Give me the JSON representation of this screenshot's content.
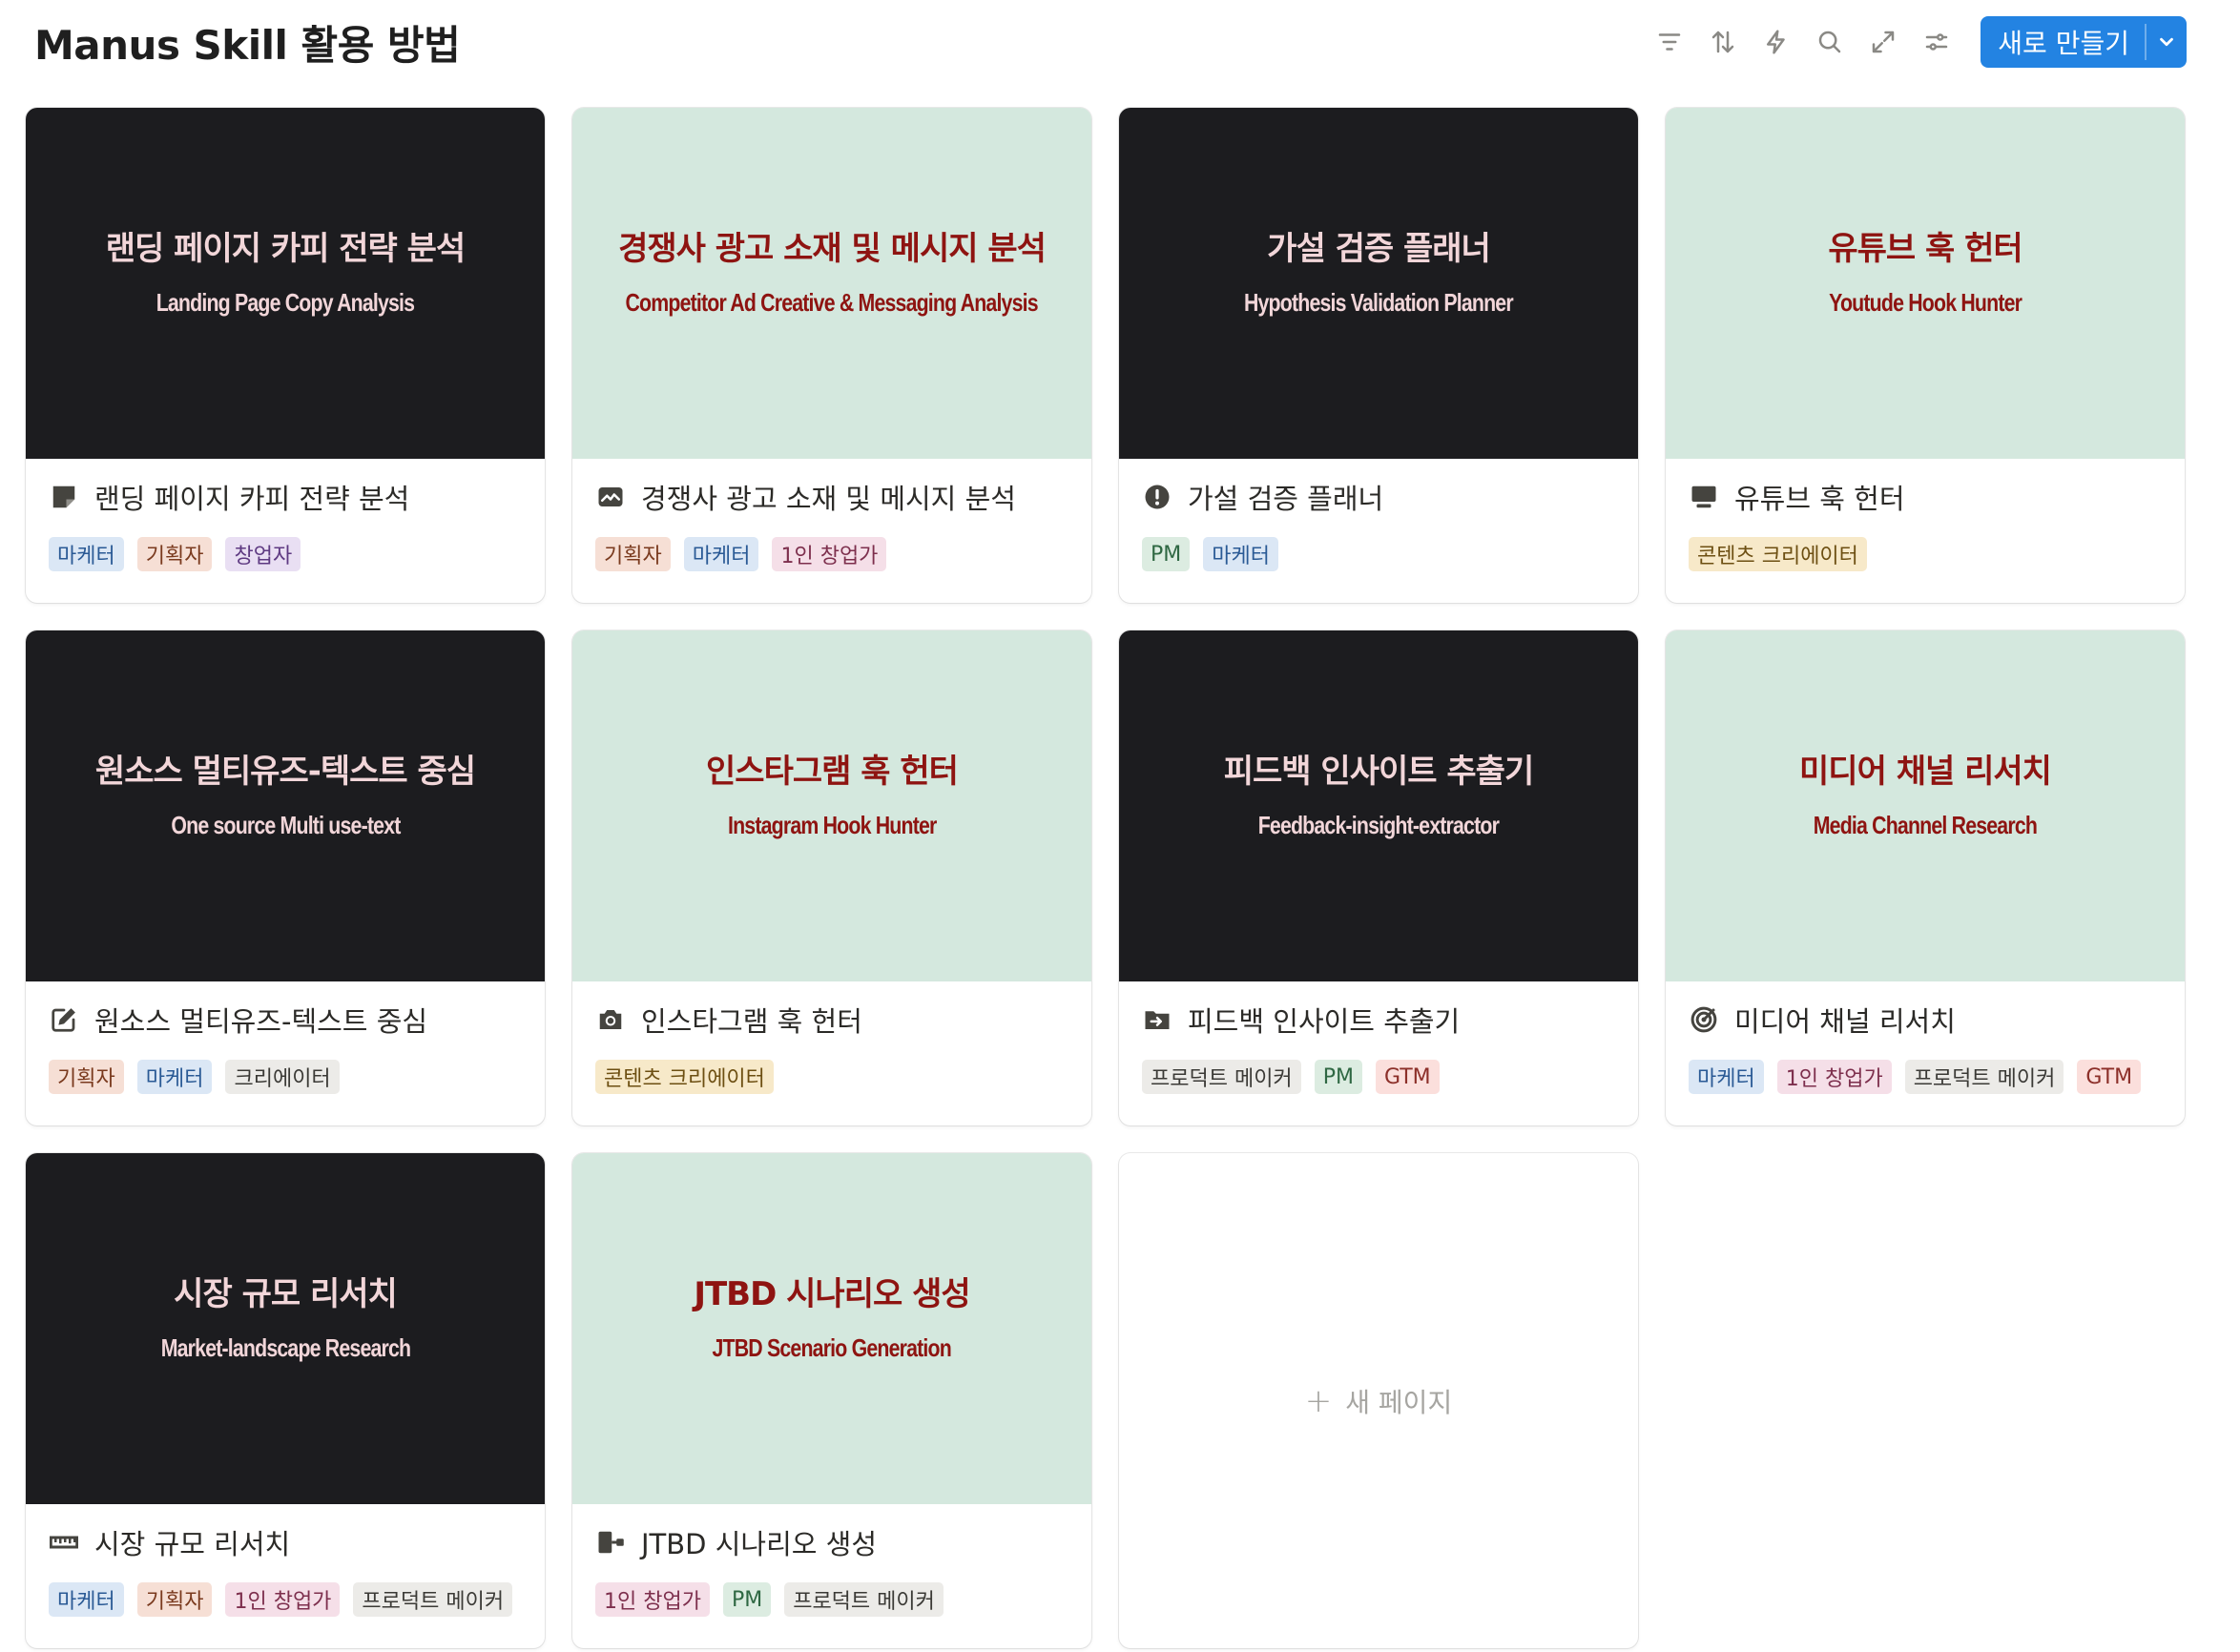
{
  "page": {
    "title": "Manus Skill 활용 방법"
  },
  "toolbar": {
    "icons": [
      "filter-icon",
      "sort-icon",
      "automation-icon",
      "search-icon",
      "expand-icon",
      "settings-icon"
    ],
    "new_label": "새로 만들기",
    "accent": "#2383e2"
  },
  "tag_colors": {
    "마케터": {
      "bg": "#dbe7f5",
      "fg": "#2a5a95"
    },
    "기획자": {
      "bg": "#f6dfd5",
      "fg": "#7a3a1e"
    },
    "창업자": {
      "bg": "#e9dff3",
      "fg": "#5e3a82"
    },
    "1인 창업가": {
      "bg": "#f5dfe8",
      "fg": "#7d2f4d"
    },
    "PM": {
      "bg": "#dcece1",
      "fg": "#2f6843"
    },
    "콘텐츠 크리에이터": {
      "bg": "#f7e9c9",
      "fg": "#6d4f12"
    },
    "크리에이터": {
      "bg": "#ecebe8",
      "fg": "#3b3a36"
    },
    "프로덕트 메이커": {
      "bg": "#ecebe8",
      "fg": "#3b3a36"
    },
    "GTM": {
      "bg": "#fbdfdc",
      "fg": "#8c2f29"
    }
  },
  "cards": [
    {
      "cover_style": "dark",
      "cover_ko": "랜딩 페이지 카피 전략 분석",
      "cover_en": "Landing Page Copy Analysis",
      "icon": "note-icon",
      "title": "랜딩 페이지 카피 전략 분석",
      "tags": [
        "마케터",
        "기획자",
        "창업자"
      ]
    },
    {
      "cover_style": "mint",
      "cover_ko": "경쟁사 광고 소재 및 메시지 분석",
      "cover_en": "Competitor Ad Creative & Messaging Analysis",
      "icon": "chart-line-icon",
      "title": "경쟁사 광고 소재 및 메시지 분석",
      "tags": [
        "기획자",
        "마케터",
        "1인 창업가"
      ]
    },
    {
      "cover_style": "dark",
      "cover_ko": "가설 검증 플래너",
      "cover_en": "Hypothesis Validation Planner",
      "icon": "alert-icon",
      "title": "가설 검증 플래너",
      "tags": [
        "PM",
        "마케터"
      ]
    },
    {
      "cover_style": "mint",
      "cover_ko": "유튜브 훅 헌터",
      "cover_en": "Youtude Hook Hunter",
      "icon": "monitor-icon",
      "title": "유튜브 훅 헌터",
      "tags": [
        "콘텐츠 크리에이터"
      ]
    },
    {
      "cover_style": "dark",
      "cover_ko": "원소스 멀티유즈-텍스트 중심",
      "cover_en": "One source Multi use-text",
      "icon": "edit-icon",
      "title": "원소스 멀티유즈-텍스트 중심",
      "tags": [
        "기획자",
        "마케터",
        "크리에이터"
      ]
    },
    {
      "cover_style": "mint",
      "cover_ko": "인스타그램 훅 헌터",
      "cover_en": "Instagram Hook Hunter",
      "icon": "camera-icon",
      "title": "인스타그램 훅 헌터",
      "tags": [
        "콘텐츠 크리에이터"
      ]
    },
    {
      "cover_style": "dark",
      "cover_ko": "피드백 인사이트 추출기",
      "cover_en": "Feedback-insight-extractor",
      "icon": "folder-arrow-icon",
      "title": "피드백 인사이트 추출기",
      "tags": [
        "프로덕트 메이커",
        "PM",
        "GTM"
      ]
    },
    {
      "cover_style": "mint",
      "cover_ko": "미디어 채널 리서치",
      "cover_en": "Media Channel Research",
      "icon": "target-icon",
      "title": "미디어 채널 리서치",
      "tags": [
        "마케터",
        "1인 창업가",
        "프로덕트 메이커",
        "GTM"
      ]
    },
    {
      "cover_style": "dark",
      "cover_ko": "시장 규모 리서치",
      "cover_en": "Market-landscape Research",
      "icon": "ruler-icon",
      "title": "시장 규모 리서치",
      "tags": [
        "마케터",
        "기획자",
        "1인 창업가",
        "프로덕트 메이커"
      ]
    },
    {
      "cover_style": "mint",
      "cover_ko": "JTBD 시나리오 생성",
      "cover_en": "JTBD Scenario Generation",
      "icon": "flowchart-icon",
      "title": "JTBD 시나리오 생성",
      "tags": [
        "1인 창업가",
        "PM",
        "프로덕트 메이커"
      ]
    }
  ],
  "new_page": {
    "plus": "+",
    "label": "새 페이지"
  }
}
